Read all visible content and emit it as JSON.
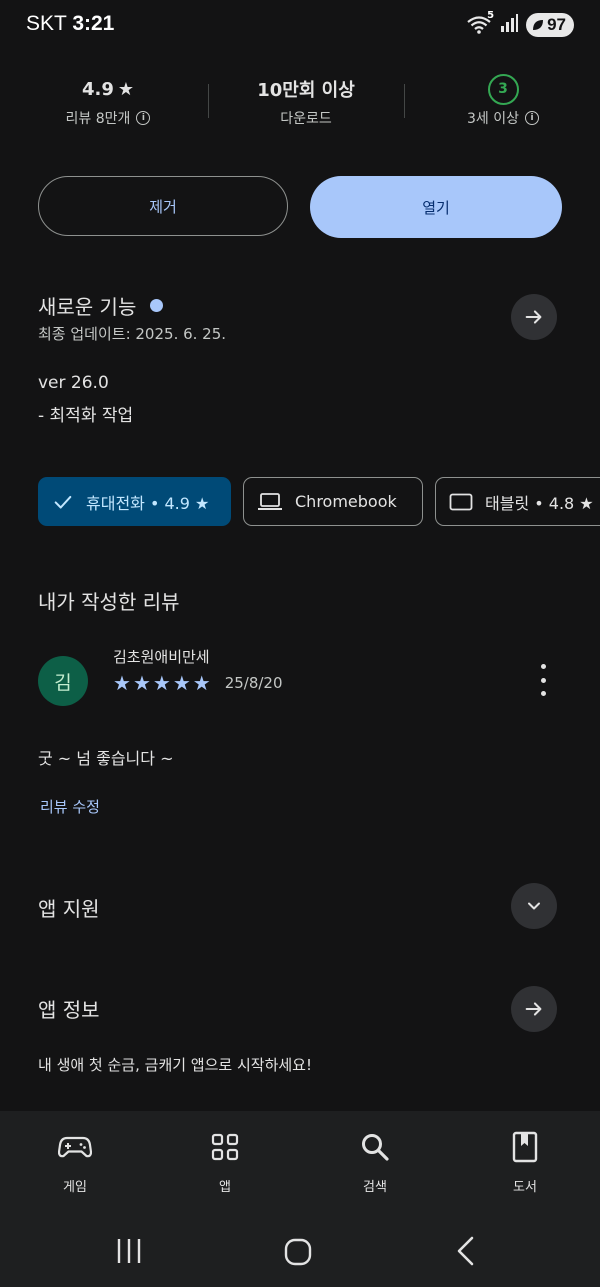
{
  "status": {
    "carrier": "SKT",
    "time": "3:21",
    "battery": "97",
    "wifi_badge": "5"
  },
  "stats": {
    "rating": {
      "value": "4.9",
      "label": "리뷰 8만개"
    },
    "downloads": {
      "value": "10만회 이상",
      "label": "다운로드"
    },
    "age": {
      "value": "3",
      "label": "3세 이상"
    }
  },
  "actions": {
    "uninstall": "제거",
    "open": "열기"
  },
  "whats_new": {
    "title": "새로운 기능",
    "updated": "최종 업데이트: 2025. 6. 25.",
    "version": "ver 26.0",
    "note": "- 최적화 작업"
  },
  "devices": [
    {
      "label": "휴대전화 • 4.9 ★",
      "selected": true
    },
    {
      "label": "Chromebook",
      "selected": false
    },
    {
      "label": "태블릿 • 4.8 ★",
      "selected": false
    }
  ],
  "my_review": {
    "title": "내가 작성한 리뷰",
    "avatar_letter": "김",
    "author": "김초원애비만세",
    "stars": 5,
    "date": "25/8/20",
    "text": "굿 ~ 넘 좋습니다 ~",
    "edit_label": "리뷰 수정"
  },
  "app_support": {
    "title": "앱 지원"
  },
  "app_info": {
    "title": "앱 정보",
    "description": "내 생애 첫 순금, 금캐기 앱으로 시작하세요!"
  },
  "bottom_nav": [
    {
      "label": "게임",
      "icon": "gamepad-icon"
    },
    {
      "label": "앱",
      "icon": "apps-grid-icon"
    },
    {
      "label": "검색",
      "icon": "search-icon"
    },
    {
      "label": "도서",
      "icon": "book-icon"
    }
  ],
  "colors": {
    "accent": "#a8c7fa",
    "background": "#131314",
    "chip_selected": "#004a77",
    "age_green": "#34a853"
  }
}
